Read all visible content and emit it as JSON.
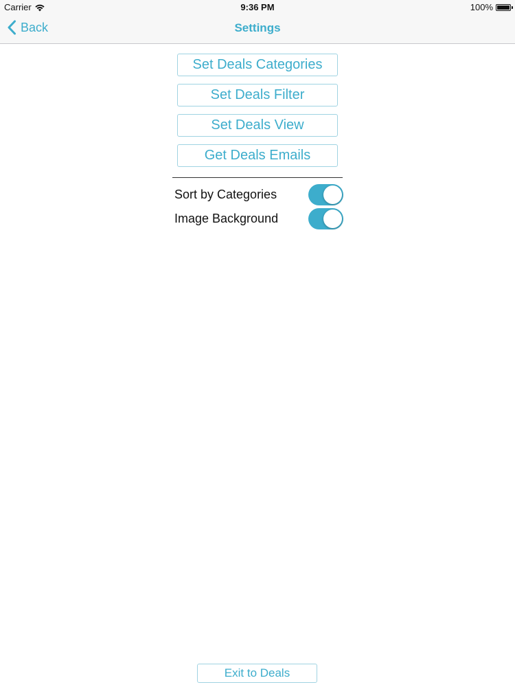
{
  "status_bar": {
    "carrier": "Carrier",
    "time": "9:36 PM",
    "battery": "100%",
    "battery_level": 1.0,
    "wifi_icon": "wifi-icon",
    "battery_icon": "battery-icon"
  },
  "nav": {
    "back_label": "Back",
    "back_icon": "chevron-left-icon",
    "title": "Settings"
  },
  "buttons": [
    {
      "label": "Set Deals Categories"
    },
    {
      "label": "Set Deals Filter"
    },
    {
      "label": "Set Deals View"
    },
    {
      "label": "Get Deals Emails"
    }
  ],
  "toggles": [
    {
      "label": "Sort by Categories",
      "on": true
    },
    {
      "label": "Image Background",
      "on": true
    }
  ],
  "footer": {
    "exit_label": "Exit to Deals"
  },
  "colors": {
    "accent": "#3dadcc",
    "button_border": "#9fd3e2",
    "bar_background": "#f7f7f7"
  }
}
